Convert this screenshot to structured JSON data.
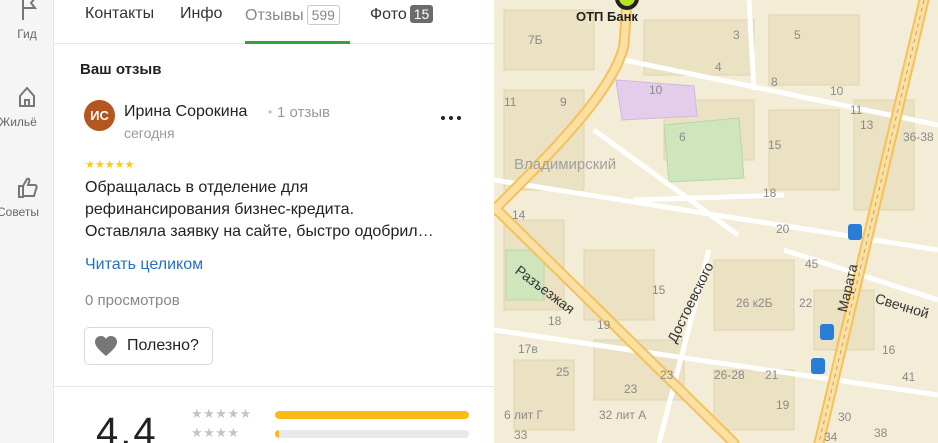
{
  "rail": {
    "items": [
      {
        "label": "Гид",
        "icon": "guide-icon"
      },
      {
        "label": "Жильё",
        "icon": "housing-icon"
      },
      {
        "label": "Советы",
        "icon": "tips-icon"
      }
    ]
  },
  "tabs": [
    {
      "label": "Контакты"
    },
    {
      "label": "Инфо"
    },
    {
      "label": "Отзывы",
      "count": "599",
      "active": true
    },
    {
      "label": "Фото",
      "count": "15"
    }
  ],
  "review": {
    "section_title": "Ваш отзыв",
    "avatar_initials": "ИС",
    "author": "Ирина Сорокина",
    "author_reviews": "1 отзыв",
    "date": "сегодня",
    "rating": 5,
    "stars": "★★★★★",
    "text_lines": [
      "Обращалась в отделение для",
      "рефинансирования бизнес-кредита.",
      "Оставляла заявку на сайте, быстро одобрил…"
    ],
    "read_more": "Читать целиком",
    "views": "0 просмотров",
    "useful_label": "Полезно?"
  },
  "rating_summary": {
    "score": "4.4",
    "rows": [
      {
        "stars": "★★★★★",
        "fraction": 1.0
      },
      {
        "stars": "★★★★",
        "fraction": 0.02
      }
    ]
  },
  "map": {
    "poi": "ОТП Банк",
    "area": "Владимирский",
    "streets": [
      "Разъезжая",
      "Достоевского",
      "Марата",
      "Свечной"
    ],
    "house_numbers": [
      "7Б",
      "11",
      "9",
      "10",
      "6",
      "4",
      "8",
      "10",
      "11",
      "13",
      "36-38",
      "15",
      "18",
      "20",
      "45",
      "14",
      "15",
      "26 к2Б",
      "22",
      "19",
      "18",
      "17в",
      "23",
      "26-28",
      "21",
      "16",
      "25",
      "23",
      "6 лит Г",
      "32 лит А",
      "19",
      "30",
      "33",
      "34",
      "38",
      "41",
      "3",
      "5"
    ],
    "colors": {
      "road_major": "#f8c95b",
      "block": "#ede4c8",
      "green": "#cfe6bd",
      "purple": "#e3cdeb"
    }
  }
}
